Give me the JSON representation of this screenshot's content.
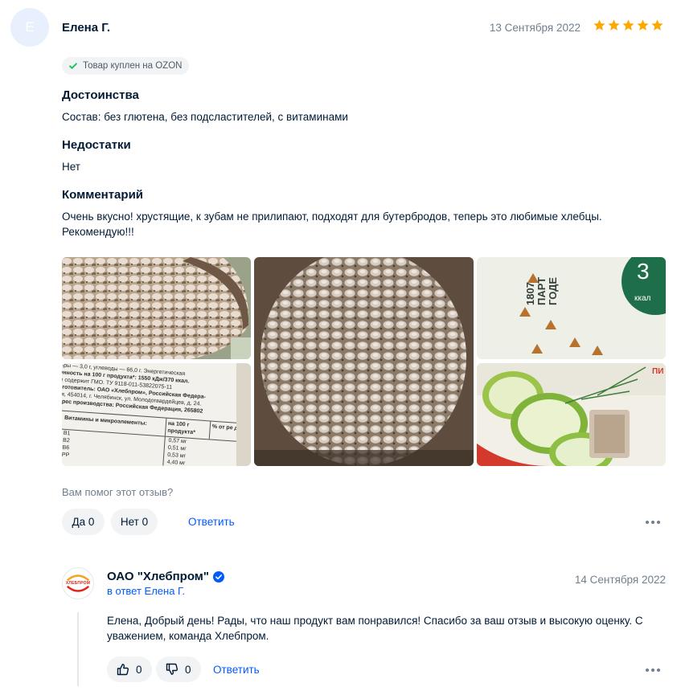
{
  "review": {
    "avatar_letter": "Е",
    "author": "Елена Г.",
    "date": "13 Сентября 2022",
    "rating": 5,
    "rating_color": "#ffa800",
    "badge": "Товар куплен на OZON",
    "sections": [
      {
        "heading": "Достоинства",
        "text": "Состав: без глютена, без подсластителей, с витаминами"
      },
      {
        "heading": "Недостатки",
        "text": "Нет"
      },
      {
        "heading": "Комментарий",
        "text": "Очень вкусно! хрустящие, к зубам не прилипают, подходят для бутербродов, теперь это любимые хлебцы. Рекомендую!!!"
      }
    ],
    "photos": [
      {
        "name": "photo-crispbread-closeup"
      },
      {
        "name": "photo-nutrition-label"
      },
      {
        "name": "photo-crispbread-large"
      },
      {
        "name": "photo-package-buckwheat"
      },
      {
        "name": "photo-package-cucumber"
      }
    ],
    "label_text": {
      "line1": "жиры — 3,0 г, углеводы — 66,0 г. Энергетическая",
      "line2": "ценность на 100 г продукта*: 1550 кДж/370 ккал.",
      "line3": "Не содержит ГМО. ТУ 9118-011-53822075-11",
      "line4": "Изготовитель: ОАО «Хлебпром», Российская Федера-",
      "line5": "ция, 454014, г. Челябинск, ул. Молодогвардейцев, д. 24.",
      "line6": "Адрес производства: Российская Федерация, 265802",
      "table_h1": "Витамины и микроэлементы:",
      "table_h2": "на 100 г продукта*",
      "table_h3": "% от ре для взро",
      "rows": [
        {
          "name": "B1",
          "value": "0,57 мг"
        },
        {
          "name": "B2",
          "value": "0,51 мг"
        },
        {
          "name": "B6",
          "value": "0,53 мг"
        },
        {
          "name": "PP",
          "value": "4,40 мг"
        }
      ]
    },
    "package_text": {
      "t1": "1807",
      "t2": "ПАРТ",
      "t3": "ГОДЕ",
      "big": "3",
      "small": "ккал",
      "pi": "ПИ"
    },
    "helpful_question": "Вам помог этот отзыв?",
    "yes_label": "Да 0",
    "no_label": "Нет 0",
    "reply_label": "Ответить"
  },
  "seller_reply": {
    "logo_text": "ХЛЕБПРОМ",
    "name": "ОАО \"Хлебпром\"",
    "verified": true,
    "reply_to": "в ответ Елена Г.",
    "date": "14 Сентября 2022",
    "text": "Елена, Добрый день! Рады, что наш продукт вам понравился! Спасибо за ваш отзыв и высокую оценку. С уважением, команда Хлебпром.",
    "likes": "0",
    "dislikes": "0",
    "reply_label": "Ответить"
  },
  "colors": {
    "accent": "#005bff",
    "verified": "#005bff",
    "check": "#10c44c"
  }
}
